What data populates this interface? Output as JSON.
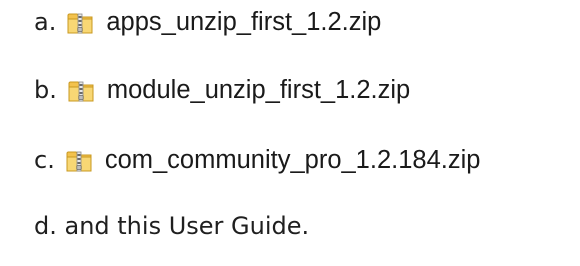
{
  "items": [
    {
      "marker": "a.",
      "icon": "zip-folder-icon",
      "name": "apps_unzip_first_1.2.zip"
    },
    {
      "marker": "b.",
      "icon": "zip-folder-icon",
      "name": "module_unzip_first_1.2.zip"
    },
    {
      "marker": "c.",
      "icon": "zip-folder-icon",
      "name": "com_community_pro_1.2.184.zip"
    }
  ],
  "footer_item": {
    "text": "d. and this User Guide."
  },
  "colors": {
    "folder": "#f6cf63",
    "folder_dark": "#d9a933",
    "zipper": "#6a6a6a"
  }
}
